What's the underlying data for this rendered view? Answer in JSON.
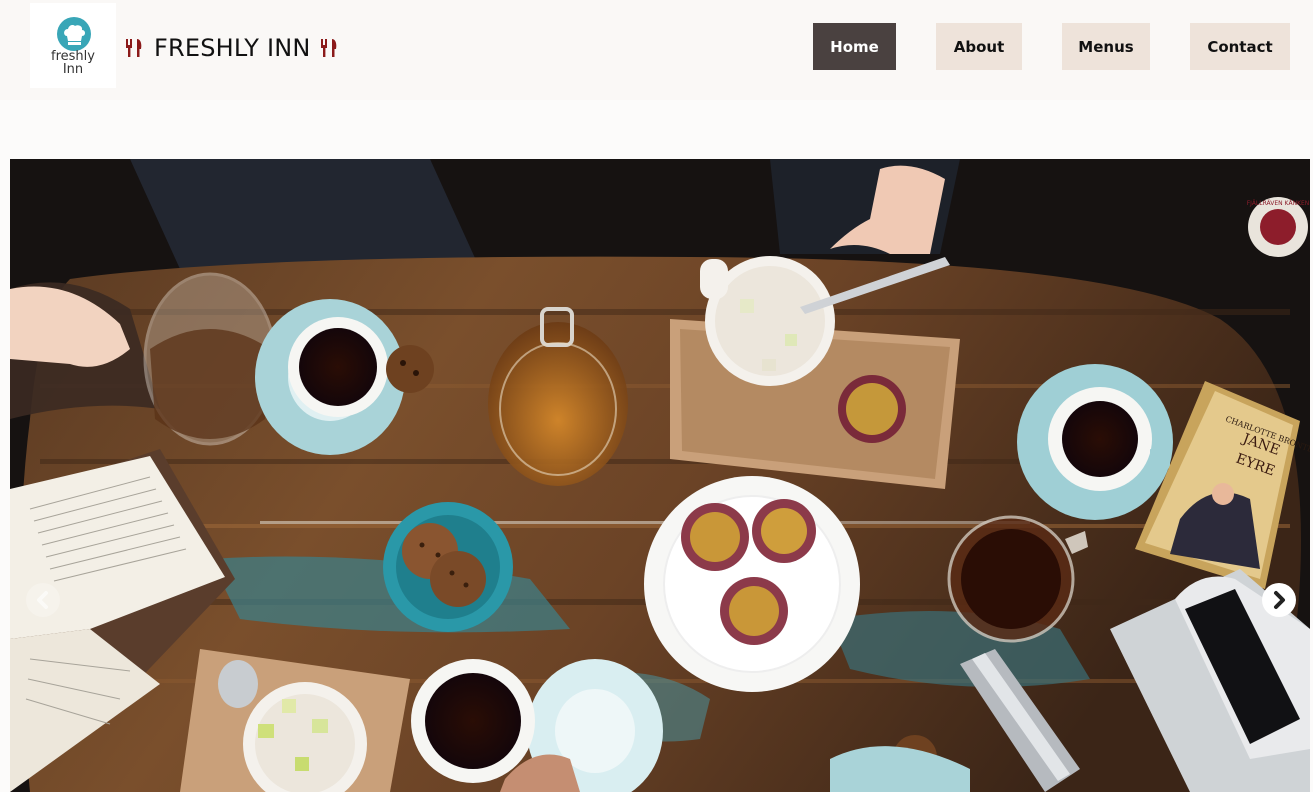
{
  "logo": {
    "line1": "freshly",
    "line2": "Inn",
    "icon": "chef-hat-icon",
    "accent": "#39a6b7"
  },
  "brand": {
    "name": "FRESHLY INN",
    "icon": "fork-knife-icon",
    "icon_color": "#8b1a1a"
  },
  "nav": {
    "items": [
      {
        "label": "Home",
        "active": true
      },
      {
        "label": "About",
        "active": false
      },
      {
        "label": "Menus",
        "active": false
      },
      {
        "label": "Contact",
        "active": false
      }
    ],
    "active_color": "#4a4140",
    "inactive_color": "#eee3da"
  },
  "hero": {
    "alt": "Overhead view of a rustic wooden table with cups of coffee, cookies, passion fruits and books",
    "book_cover_lines": [
      "CHARLOTTE BRONTË",
      "JANE",
      "EYRE"
    ],
    "badge_text": "FJÄLLRÄVEN KÅNKEN",
    "prev_icon": "chevron-left-icon",
    "next_icon": "chevron-right-icon"
  }
}
